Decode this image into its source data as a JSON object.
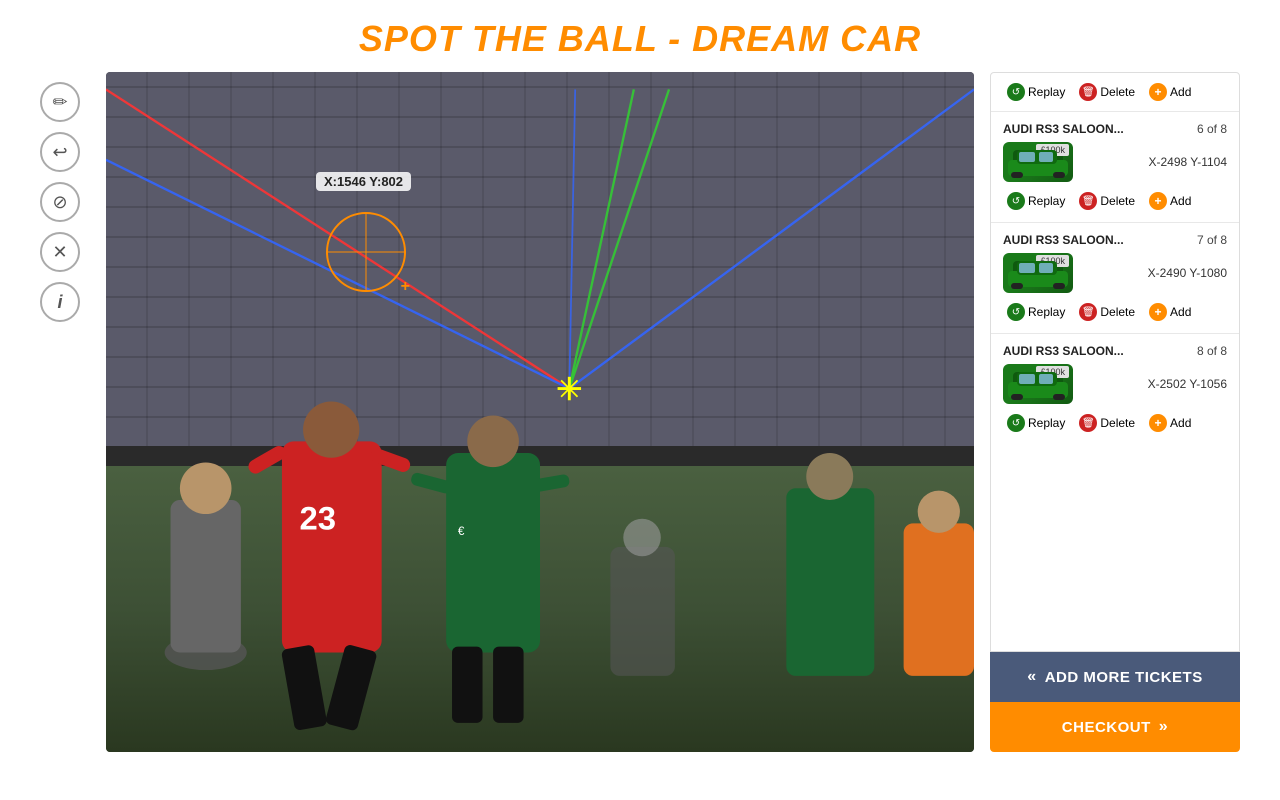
{
  "title": "SPOT THE BALL - DREAM CAR",
  "coord_label": "X:1546  Y:802",
  "tools": [
    {
      "name": "pencil-icon",
      "symbol": "✏"
    },
    {
      "name": "undo-icon",
      "symbol": "↩"
    },
    {
      "name": "eye-icon",
      "symbol": "⊘"
    },
    {
      "name": "close-icon",
      "symbol": "✕"
    },
    {
      "name": "info-icon",
      "symbol": "i"
    }
  ],
  "tickets": [
    {
      "id": "ticket-5",
      "name": "AUDI RS3 SALOON...",
      "count": "6 of 8",
      "price": "£100k",
      "coords": "X-2498 Y-1104",
      "car_color": "#1a7a1a"
    },
    {
      "id": "ticket-6",
      "name": "AUDI RS3 SALOON...",
      "count": "7 of 8",
      "price": "£100k",
      "coords": "X-2490 Y-1080",
      "car_color": "#1a7a1a"
    },
    {
      "id": "ticket-7",
      "name": "AUDI RS3 SALOON...",
      "count": "8 of 8",
      "price": "£100k",
      "coords": "X-2502 Y-1056",
      "car_color": "#1a7a1a"
    }
  ],
  "buttons": {
    "add_tickets": "ADD MORE TICKETS",
    "checkout": "CHECKOUT",
    "replay": "Replay",
    "delete": "Delete",
    "add": "Add"
  }
}
